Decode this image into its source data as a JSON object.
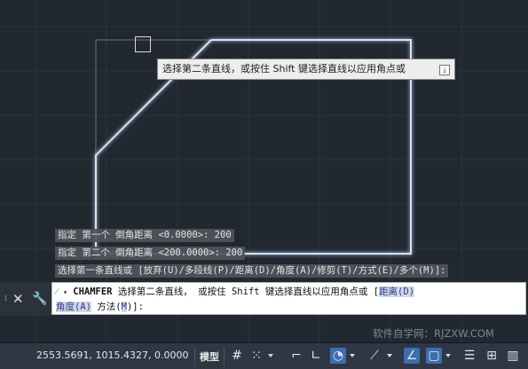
{
  "tooltip": {
    "text": "选择第二条直线，或按住 Shift 键选择直线以应用角点或",
    "expand_icon": "expand-arrow-icon"
  },
  "history": [
    "指定 第一个 倒角距离 <0.0000>: 200",
    "指定 第二个 倒角距离 <200.0000>: 200",
    "选择第一条直线或 [放弃(U)/多段线(P)/距离(D)/角度(A)/修剪(T)/方式(E)/多个(M)]:"
  ],
  "command": {
    "name": "CHAMFER",
    "prompt": "选择第二条直线， 或按住 Shift 键选择直线以应用角点或 [",
    "option1": "距离(D)",
    "option2": "角度(A)",
    "option3_pre": "方法(",
    "option3_key": "M",
    "option3_post": ")]:"
  },
  "status": {
    "coordinates": "2553.5691, 1015.4327, 0.0000",
    "model_label": "模型"
  },
  "watermark": "软件自学网：RJZXW.COM",
  "icons": [
    "grip-icon",
    "close-icon",
    "wrench-icon",
    "command-icon",
    "grid-icon",
    "snap-icon",
    "ortho-icon",
    "polar-icon",
    "isodraft-icon",
    "osnap-icon",
    "annotation-icon",
    "monitor-icon"
  ]
}
